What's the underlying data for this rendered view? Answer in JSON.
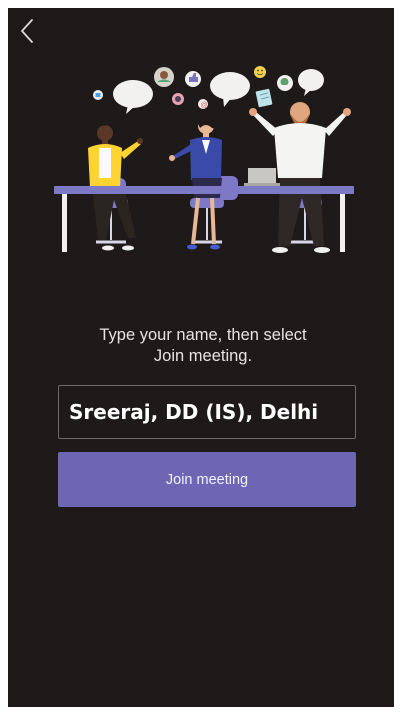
{
  "header": {
    "back_icon": "chevron-left-icon"
  },
  "illustration": {
    "subject": "people-at-meeting-table"
  },
  "prompt": {
    "text": "Type your name, then select\nJoin meeting."
  },
  "name_field": {
    "value": "Sreeraj, DD (IS), Delhi",
    "placeholder": ""
  },
  "join_button": {
    "label": "Join meeting"
  },
  "colors": {
    "background": "#1d1a19",
    "accent": "#6e66b4",
    "text": "#e7e5e3",
    "field_border": "#6f6a67"
  }
}
